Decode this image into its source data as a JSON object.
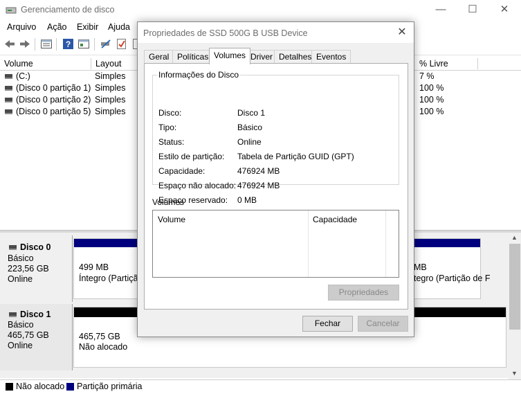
{
  "app": {
    "title": "Gerenciamento de disco",
    "minimize_glyph": "—",
    "maximize_glyph": "☐",
    "close_glyph": "✕"
  },
  "menu": [
    "Arquivo",
    "Ação",
    "Exibir",
    "Ajuda"
  ],
  "toolbar": {
    "icons": [
      "back-arrow-icon",
      "forward-arrow-icon",
      "list-view-icon",
      "help-icon",
      "properties-icon",
      "connect-icon",
      "check-icon",
      "document-icon"
    ]
  },
  "volume_list": {
    "columns": [
      "Volume",
      "Layout",
      "% Livre"
    ],
    "rows": [
      {
        "volume": "(C:)",
        "layout": "Simples",
        "free": "7 %"
      },
      {
        "volume": "(Disco 0 partição 1)",
        "layout": "Simples",
        "free": "100 %"
      },
      {
        "volume": "(Disco 0 partição 2)",
        "layout": "Simples",
        "free": "100 %"
      },
      {
        "volume": "(Disco 0 partição 5)",
        "layout": "Simples",
        "free": "100 %"
      }
    ]
  },
  "disks": [
    {
      "name": "Disco 0",
      "type": "Básico",
      "size": "223,56 GB",
      "status": "Online",
      "left_part": {
        "size": "499 MB",
        "status": "Íntegro (Partição"
      },
      "right_part": {
        "size": "MB",
        "status": "tegro (Partição de F"
      }
    },
    {
      "name": "Disco 1",
      "type": "Básico",
      "size": "465,75 GB",
      "status": "Online",
      "part": {
        "size": "465,75 GB",
        "status": "Não alocado"
      }
    }
  ],
  "legend": [
    {
      "label": "Não alocado",
      "color": "#000000"
    },
    {
      "label": "Partição primária",
      "color": "#00007f"
    }
  ],
  "colors": {
    "primary_partition": "#00007f",
    "unallocated": "#000000"
  },
  "dialog": {
    "title": "Propriedades de SSD 500G B USB Device",
    "close_glyph": "✕",
    "tabs": [
      "Geral",
      "Políticas",
      "Volumes",
      "Driver",
      "Detalhes",
      "Eventos"
    ],
    "active_tab": "Volumes",
    "info_group_title": "Informações do Disco",
    "info": [
      {
        "label": "Disco:",
        "value": "Disco 1"
      },
      {
        "label": "Tipo:",
        "value": "Básico"
      },
      {
        "label": "Status:",
        "value": "Online"
      },
      {
        "label": "Estilo de partição:",
        "value": "Tabela de Partição GUID (GPT)"
      },
      {
        "label": "Capacidade:",
        "value": "476924 MB"
      },
      {
        "label": "Espaço não alocado:",
        "value": "476924 MB"
      },
      {
        "label": "Espaço reservado:",
        "value": "0 MB"
      }
    ],
    "volumes_label": "Volumes",
    "volumes_columns": [
      "Volume",
      "Capacidade"
    ],
    "properties_button": "Propriedades",
    "ok_button": "Fechar",
    "cancel_button": "Cancelar"
  }
}
